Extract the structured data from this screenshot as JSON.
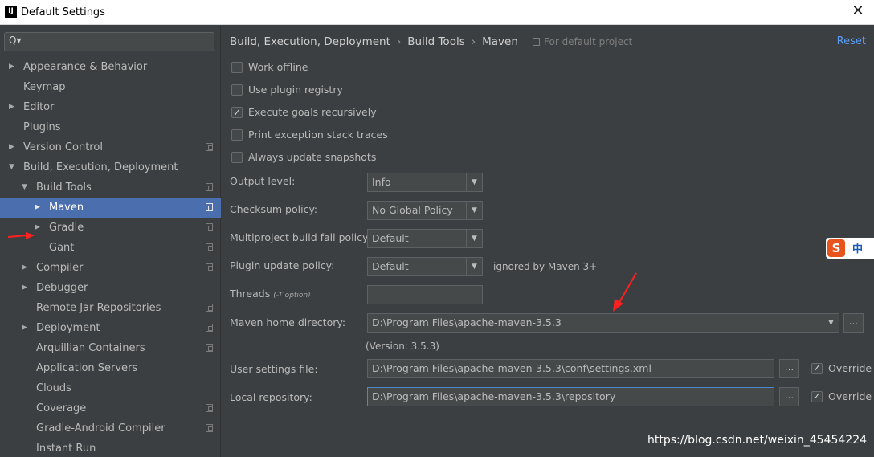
{
  "window": {
    "title": "Default Settings",
    "app_icon": "IJ",
    "close_glyph": "✕"
  },
  "sidebar": {
    "search": {
      "glyph": "Q▾",
      "value": ""
    },
    "items": [
      {
        "label": "Appearance & Behavior",
        "level": 0,
        "expandable": true,
        "expanded": false,
        "project_icon": false,
        "selected": false
      },
      {
        "label": "Keymap",
        "level": 0,
        "expandable": false,
        "expanded": false,
        "project_icon": false,
        "selected": false
      },
      {
        "label": "Editor",
        "level": 0,
        "expandable": true,
        "expanded": false,
        "project_icon": false,
        "selected": false
      },
      {
        "label": "Plugins",
        "level": 0,
        "expandable": false,
        "expanded": false,
        "project_icon": false,
        "selected": false
      },
      {
        "label": "Version Control",
        "level": 0,
        "expandable": true,
        "expanded": false,
        "project_icon": true,
        "selected": false
      },
      {
        "label": "Build, Execution, Deployment",
        "level": 0,
        "expandable": true,
        "expanded": true,
        "project_icon": false,
        "selected": false
      },
      {
        "label": "Build Tools",
        "level": 1,
        "expandable": true,
        "expanded": true,
        "project_icon": true,
        "selected": false
      },
      {
        "label": "Maven",
        "level": 2,
        "expandable": true,
        "expanded": false,
        "project_icon": true,
        "selected": true
      },
      {
        "label": "Gradle",
        "level": 2,
        "expandable": true,
        "expanded": false,
        "project_icon": true,
        "selected": false
      },
      {
        "label": "Gant",
        "level": 2,
        "expandable": false,
        "expanded": false,
        "project_icon": true,
        "selected": false
      },
      {
        "label": "Compiler",
        "level": 1,
        "expandable": true,
        "expanded": false,
        "project_icon": true,
        "selected": false
      },
      {
        "label": "Debugger",
        "level": 1,
        "expandable": true,
        "expanded": false,
        "project_icon": false,
        "selected": false
      },
      {
        "label": "Remote Jar Repositories",
        "level": 1,
        "expandable": false,
        "expanded": false,
        "project_icon": true,
        "selected": false
      },
      {
        "label": "Deployment",
        "level": 1,
        "expandable": true,
        "expanded": false,
        "project_icon": true,
        "selected": false
      },
      {
        "label": "Arquillian Containers",
        "level": 1,
        "expandable": false,
        "expanded": false,
        "project_icon": true,
        "selected": false
      },
      {
        "label": "Application Servers",
        "level": 1,
        "expandable": false,
        "expanded": false,
        "project_icon": false,
        "selected": false
      },
      {
        "label": "Clouds",
        "level": 1,
        "expandable": false,
        "expanded": false,
        "project_icon": false,
        "selected": false
      },
      {
        "label": "Coverage",
        "level": 1,
        "expandable": false,
        "expanded": false,
        "project_icon": true,
        "selected": false
      },
      {
        "label": "Gradle-Android Compiler",
        "level": 1,
        "expandable": false,
        "expanded": false,
        "project_icon": true,
        "selected": false
      },
      {
        "label": "Instant Run",
        "level": 1,
        "expandable": false,
        "expanded": false,
        "project_icon": false,
        "selected": false
      }
    ]
  },
  "header": {
    "breadcrumb": [
      "Build, Execution, Deployment",
      "Build Tools",
      "Maven"
    ],
    "breadcrumb_sep": "›",
    "scope": "For default project",
    "reset": "Reset"
  },
  "options": [
    {
      "label": "Work offline",
      "checked": false
    },
    {
      "label": "Use plugin registry",
      "checked": false
    },
    {
      "label": "Execute goals recursively",
      "checked": true
    },
    {
      "label": "Print exception stack traces",
      "checked": false
    },
    {
      "label": "Always update snapshots",
      "checked": false
    }
  ],
  "fields": {
    "output_level": {
      "label": "Output level:",
      "value": "Info"
    },
    "checksum_policy": {
      "label": "Checksum policy:",
      "value": "No Global Policy"
    },
    "fail_policy": {
      "label": "Multiproject build fail policy:",
      "value": "Default"
    },
    "plugin_update": {
      "label": "Plugin update policy:",
      "value": "Default",
      "note": "ignored by Maven 3+"
    },
    "threads": {
      "label": "Threads",
      "hint": "(-T option)",
      "value": ""
    },
    "maven_home": {
      "label": "Maven home directory:",
      "value": "D:\\Program Files\\apache-maven-3.5.3",
      "version": "(Version: 3.5.3)"
    },
    "user_settings": {
      "label": "User settings file:",
      "value": "D:\\Program Files\\apache-maven-3.5.3\\conf\\settings.xml",
      "override_label": "Override",
      "override": true
    },
    "local_repo": {
      "label": "Local repository:",
      "value": "D:\\Program Files\\apache-maven-3.5.3\\repository",
      "override_label": "Override",
      "override": true
    }
  },
  "controls": {
    "dropdown_glyph": "▼",
    "browse_glyph": "..."
  },
  "overlay": {
    "ime_logo": "S",
    "ime_lang": "中",
    "watermark": "https://blog.csdn.net/weixin_45454224"
  },
  "colors": {
    "background": "#3c3f41",
    "selection": "#4b6eaf",
    "link": "#589df6",
    "annotation_arrow": "#ff2020"
  }
}
